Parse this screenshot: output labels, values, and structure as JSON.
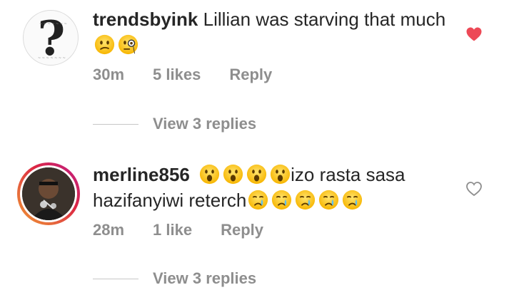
{
  "comments": [
    {
      "username": "trendsbyink",
      "text": "Lillian was starving that much",
      "emojis": [
        "confused-face-icon",
        "monocle-face-icon"
      ],
      "time": "30m",
      "likes": "5 likes",
      "reply_label": "Reply",
      "view_replies": "View 3 replies",
      "liked": true,
      "heart_color": "#ed4956"
    },
    {
      "username": "merline856",
      "text_prefix_emojis": [
        "astonished-face-icon",
        "astonished-face-icon",
        "astonished-face-icon",
        "astonished-face-icon"
      ],
      "text": "izo rasta sasa hazifanyiwi reterch",
      "emojis": [
        "crying-face-icon",
        "crying-face-icon",
        "crying-face-icon",
        "crying-face-icon",
        "crying-face-icon"
      ],
      "time": "28m",
      "likes": "1 like",
      "reply_label": "Reply",
      "view_replies": "View 3 replies",
      "liked": false,
      "heart_color": "#8e8e8e"
    }
  ],
  "colors": {
    "text": "#262626",
    "secondary": "#8e8e8e",
    "like": "#ed4956"
  }
}
